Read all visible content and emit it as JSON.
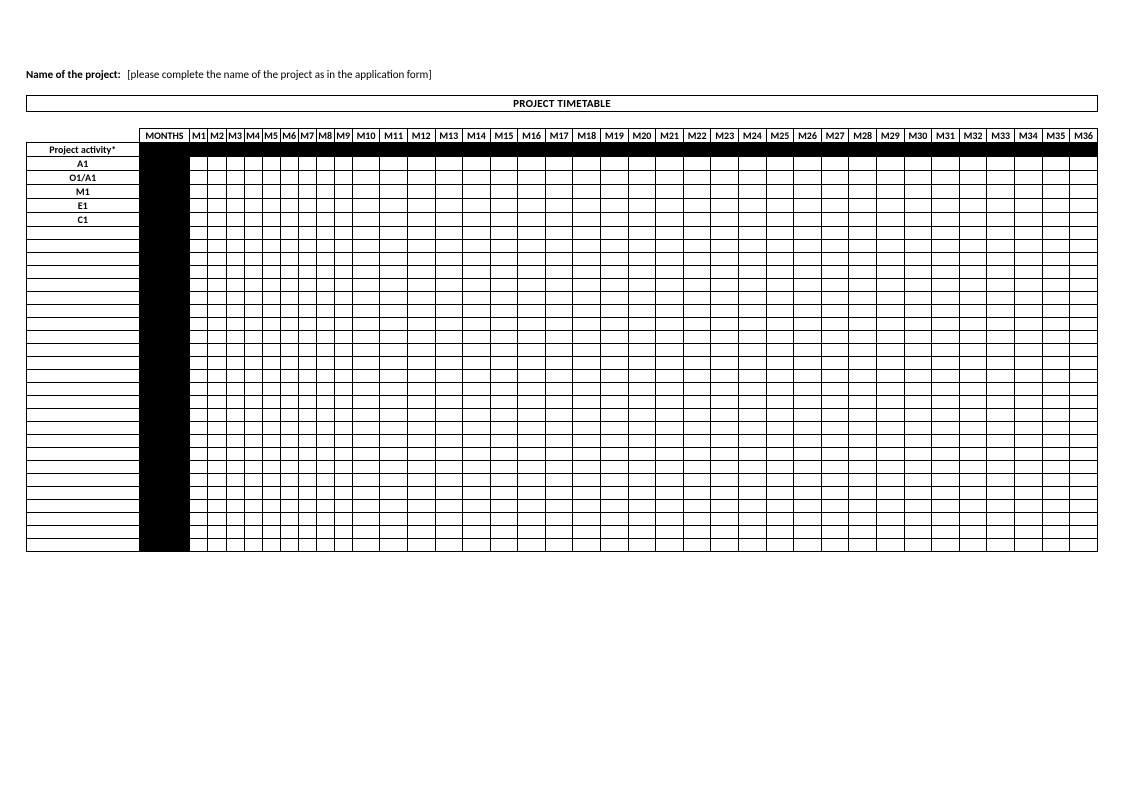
{
  "header": {
    "name_label": "Name of the project:",
    "name_placeholder": "[please complete the name of the project as in the application form]",
    "title": "PROJECT TIMETABLE"
  },
  "table": {
    "activity_header": "Project activity*",
    "months_header": "MONTHS",
    "month_columns": [
      "M1",
      "M2",
      "M3",
      "M4",
      "M5",
      "M6",
      "M7",
      "M8",
      "M9",
      "M10",
      "M11",
      "M12",
      "M13",
      "M14",
      "M15",
      "M16",
      "M17",
      "M18",
      "M19",
      "M20",
      "M21",
      "M22",
      "M23",
      "M24",
      "M25",
      "M26",
      "M27",
      "M28",
      "M29",
      "M30",
      "M31",
      "M32",
      "M33",
      "M34",
      "M35",
      "M36"
    ],
    "activities": [
      "A1",
      "O1/A1",
      "M1",
      "E1",
      "C1"
    ],
    "empty_rows": 25
  }
}
